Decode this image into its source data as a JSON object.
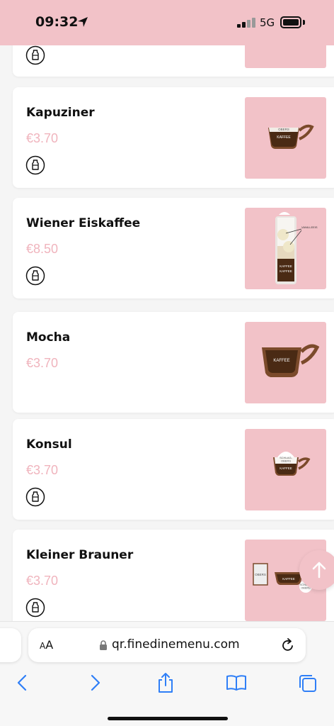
{
  "status_bar": {
    "time": "09:32",
    "network": "5G"
  },
  "items": [
    {
      "name": "",
      "price": "",
      "has_milk_icon": true
    },
    {
      "name": "Kapuziner",
      "price": "€3.70",
      "has_milk_icon": true,
      "image_labels": [
        "OBERS",
        "KAFFEE"
      ]
    },
    {
      "name": "Wiener Eiskaffee",
      "price": "€8.50",
      "has_milk_icon": true,
      "image_labels": [
        "VANILLEEIS",
        "KAFFEE",
        "KAFFEE"
      ]
    },
    {
      "name": "Mocha",
      "price": "€3.70",
      "has_milk_icon": false,
      "image_labels": [
        "KAFFEE"
      ]
    },
    {
      "name": "Konsul",
      "price": "€3.70",
      "has_milk_icon": true,
      "image_labels": [
        "SCHLAG-",
        "OBERS",
        "KAFFEE"
      ]
    },
    {
      "name": "Kleiner Brauner",
      "price": "€3.70",
      "has_milk_icon": true,
      "image_labels": [
        "OBERS",
        "KAFFEE",
        "SCHLAG-",
        "OBERS"
      ]
    }
  ],
  "browser": {
    "text_size_small": "A",
    "text_size_large": "A",
    "url": "qr.finedinemenu.com"
  },
  "icons": {
    "location": "location-arrow-icon",
    "milk": "milk-bottle-icon",
    "scroll_top": "arrow-up-icon",
    "lock": "lock-icon",
    "reload": "reload-icon",
    "back": "chevron-left-icon",
    "forward": "chevron-right-icon",
    "share": "share-icon",
    "bookmarks": "book-icon",
    "tabs": "tabs-icon"
  },
  "colors": {
    "brand_pink": "#f2c2c8",
    "price_pink": "#f0b4bd",
    "coffee_brown": "#6b4327",
    "safari_blue": "#2f7ff7"
  }
}
